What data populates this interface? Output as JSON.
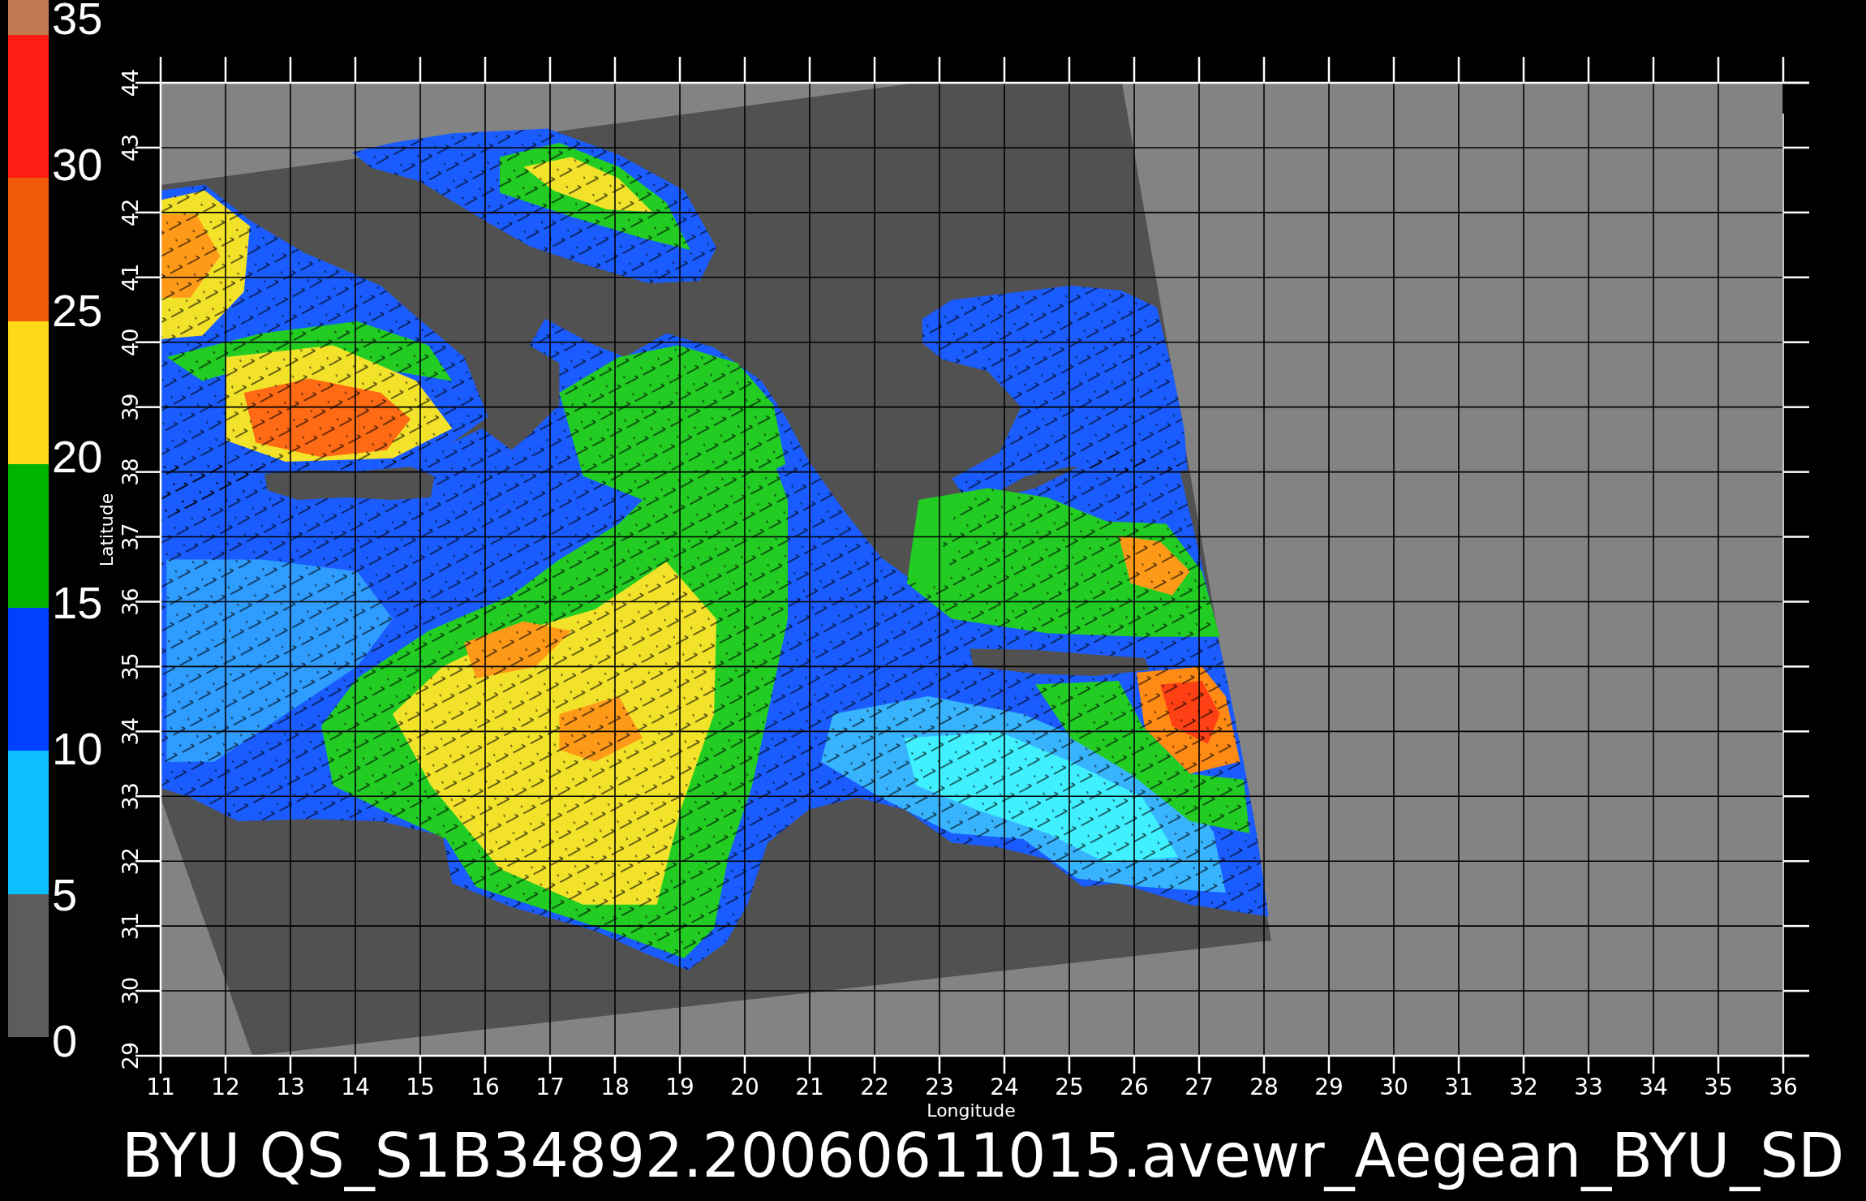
{
  "colorbar": {
    "labels": [
      "35",
      "30",
      "25",
      "20",
      "15",
      "10",
      "5",
      "0"
    ],
    "segments": [
      {
        "color": "#c27a52"
      },
      {
        "color": "#ff1c14"
      },
      {
        "color": "#f05a08"
      },
      {
        "color": "#ffd818"
      },
      {
        "color": "#00b400"
      },
      {
        "color": "#0040ff"
      },
      {
        "color": "#0cc0ff"
      },
      {
        "color": "#5c5c5c"
      }
    ]
  },
  "map": {
    "x_axis": {
      "title": "Longitude",
      "ticks": [
        "11",
        "12",
        "13",
        "14",
        "15",
        "16",
        "17",
        "18",
        "19",
        "20",
        "21",
        "22",
        "23",
        "24",
        "25",
        "26",
        "27",
        "28",
        "29",
        "30",
        "31",
        "32",
        "33",
        "34",
        "35",
        "36"
      ]
    },
    "y_axis": {
      "title": "Latitude",
      "ticks": [
        "29",
        "30",
        "31",
        "32",
        "33",
        "34",
        "35",
        "36",
        "37",
        "38",
        "39",
        "40",
        "41",
        "42",
        "43",
        "44"
      ]
    }
  },
  "title": "BYU QS_S1B34892.20060611015.avewr_Aegean_BYU_SD"
}
